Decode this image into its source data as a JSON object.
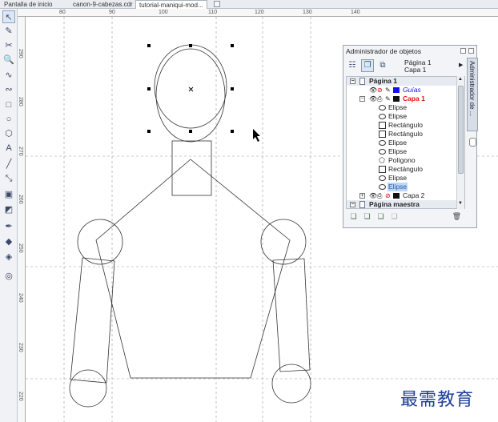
{
  "tabs": [
    {
      "label": "Pantalla de inicio"
    },
    {
      "label": "canon-9-cabezas.cdr"
    },
    {
      "label": "tutorial-maniqui-mod..."
    }
  ],
  "hruler_labels": [
    "80",
    "90",
    "100",
    "110",
    "120",
    "130",
    "140"
  ],
  "vruler_labels": [
    "290",
    "280",
    "270",
    "260",
    "250",
    "240",
    "230",
    "220",
    "210",
    "200",
    "190"
  ],
  "panel": {
    "title": "Administrador de objetos",
    "page_line1": "Página 1",
    "page_line2": "Capa 1",
    "side_tab": "Administrador de ...",
    "tree": {
      "page1": "Página 1",
      "guias": "Guías",
      "capa1": "Capa 1",
      "objects": [
        "Elipse",
        "Elipse",
        "Rectángulo",
        "Rectángulo",
        "Elipse",
        "Elipse",
        "Polígono",
        "Rectángulo",
        "Elipse",
        "Elipse"
      ],
      "capa2": "Capa 2",
      "master": "Página maestra"
    },
    "colors": {
      "guias": "#1111ee",
      "capa1": "#dd1111",
      "capa1_swatch": "#111111",
      "capa2_swatch": "#111111",
      "selected": "#bcd6f5"
    }
  },
  "watermark": "最需教育"
}
